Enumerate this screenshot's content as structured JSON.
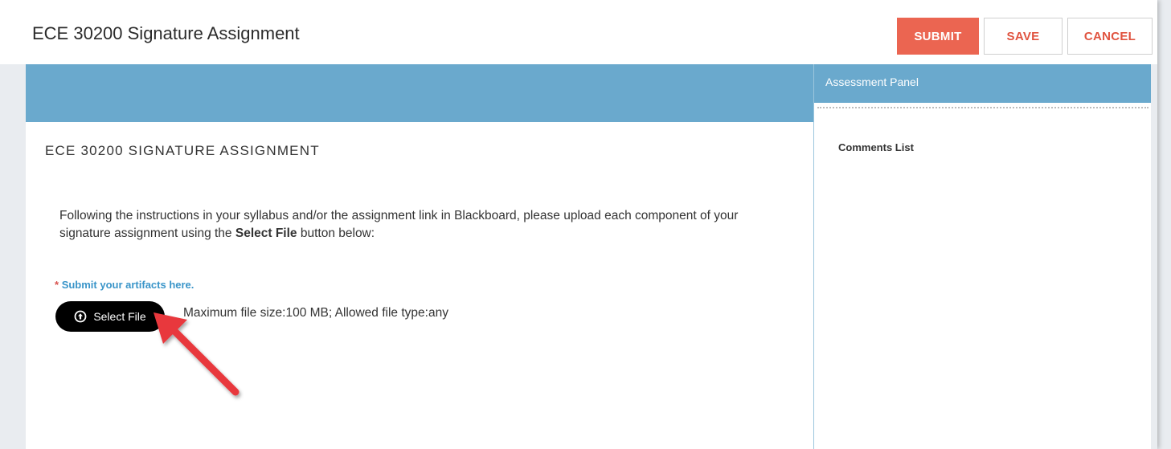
{
  "header": {
    "title": "ECE 30200 Signature Assignment",
    "submit_label": "SUBMIT",
    "save_label": "SAVE",
    "cancel_label": "CANCEL"
  },
  "assessment_panel": {
    "title": "Assessment Panel",
    "comments_title": "Comments List"
  },
  "main": {
    "section_title": "ECE 30200 SIGNATURE ASSIGNMENT",
    "instructions_before": "Following the instructions in your syllabus and/or the assignment link in Blackboard, please upload each component of your signature assignment using the ",
    "instructions_bold": "Select File",
    "instructions_after": " button below:",
    "required_asterisk": "*",
    "required_label": "Submit your artifacts here.",
    "select_file_label": "Select File",
    "file_info": "Maximum file size:100 MB; Allowed file type:any"
  },
  "icons": {
    "upload": "upload-circle-icon",
    "annotation": "red-arrow-icon"
  },
  "colors": {
    "accent_blue": "#6aa9cd",
    "submit_red": "#eb6551",
    "link_red": "#e0533f",
    "label_blue": "#3a95c9",
    "arrow_red": "#e8373d"
  }
}
